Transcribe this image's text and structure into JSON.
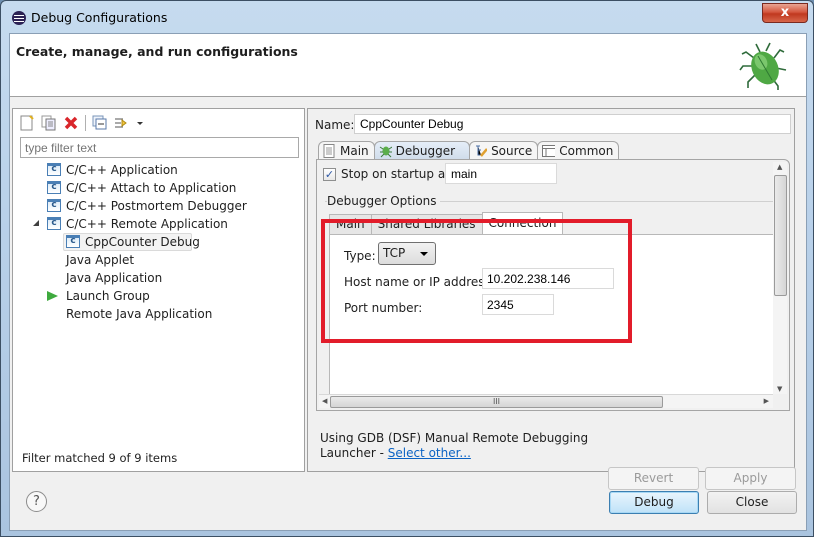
{
  "window": {
    "title": "Debug Configurations",
    "close_label": "x"
  },
  "header": {
    "title": "Create, manage, and run configurations",
    "icon": "bug-icon"
  },
  "left_panel": {
    "toolbar_icons": [
      "new-configuration-icon",
      "duplicate-icon",
      "delete-icon",
      "collapse-all-icon",
      "filter-icon",
      "dropdown-icon"
    ],
    "filter_placeholder": "type filter text",
    "tree": [
      {
        "label": "C/C++ Application",
        "icon": "c-app-icon",
        "level": 0
      },
      {
        "label": "C/C++ Attach to Application",
        "icon": "c-app-icon",
        "level": 0
      },
      {
        "label": "C/C++ Postmortem Debugger",
        "icon": "c-app-icon",
        "level": 0
      },
      {
        "label": "C/C++ Remote Application",
        "icon": "c-app-icon",
        "level": 0,
        "expanded": true
      },
      {
        "label": "CppCounter Debug",
        "icon": "c-app-icon",
        "level": 1,
        "selected": true
      },
      {
        "label": "Java Applet",
        "icon": "",
        "level": 0
      },
      {
        "label": "Java Application",
        "icon": "",
        "level": 0
      },
      {
        "label": "Launch Group",
        "icon": "launch-group-icon",
        "level": 0
      },
      {
        "label": "Remote Java Application",
        "icon": "",
        "level": 0
      }
    ],
    "status": "Filter matched 9 of 9 items"
  },
  "right_panel": {
    "name_label": "Name:",
    "name_value": "CppCounter Debug",
    "tabs": [
      {
        "label": "Main",
        "icon": "main-tab-icon"
      },
      {
        "label": "Debugger",
        "icon": "debugger-tab-icon",
        "active": true
      },
      {
        "label": "Source",
        "icon": "source-tab-icon"
      },
      {
        "label": "Common",
        "icon": "common-tab-icon"
      }
    ],
    "stop_on_startup": {
      "label": "Stop on startup at:",
      "checked": true,
      "value": "main"
    },
    "debugger_options_label": "Debugger Options",
    "inner_tabs": [
      {
        "label": "Main"
      },
      {
        "label": "Shared Libraries"
      },
      {
        "label": "Connection",
        "active": true
      }
    ],
    "connection": {
      "type_label": "Type:",
      "type_value": "TCP",
      "host_label": "Host name or IP address:",
      "host_value": "10.202.238.146",
      "port_label": "Port number:",
      "port_value": "2345"
    },
    "launcher_text": "Using GDB (DSF) Manual Remote Debugging",
    "launcher_prefix": "Launcher - ",
    "launcher_link": "Select other...",
    "revert_label": "Revert",
    "apply_label": "Apply"
  },
  "footer": {
    "help_label": "?",
    "debug_label": "Debug",
    "close_label": "Close"
  },
  "colors": {
    "highlight": "#e21c2a",
    "link": "#0b63c4",
    "launch_green": "#3eaa3e"
  }
}
